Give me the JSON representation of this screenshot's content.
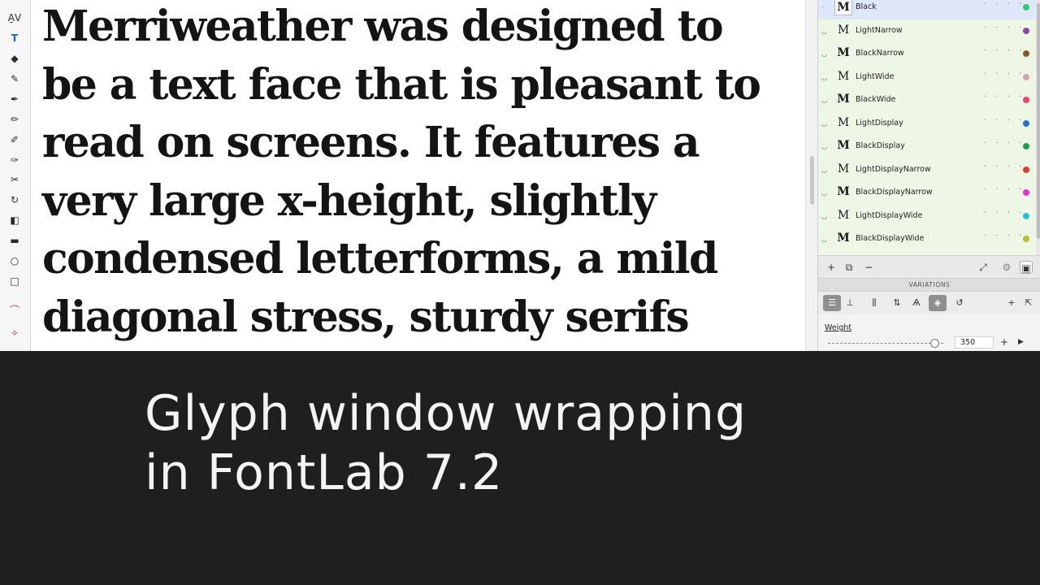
{
  "canvas": {
    "sample_text": "Merriweather was designed to\nbe a text face that is pleasant to\nread on screens. It features a\nvery large x-height, slightly\ncondensed letterforms, a mild\ndiagonal stress, sturdy serifs"
  },
  "toolbar": {
    "tools": [
      {
        "icon": "kerning-icon",
        "glyph": "A̱V",
        "active": false
      },
      {
        "icon": "text-tool-icon",
        "glyph": "T",
        "active": true
      },
      {
        "icon": "eraser-icon",
        "glyph": "◆",
        "active": false
      },
      {
        "icon": "brush-icon",
        "glyph": "✎",
        "active": false
      },
      {
        "icon": "pen-icon",
        "glyph": "✒",
        "active": false
      },
      {
        "icon": "pencil-icon",
        "glyph": "✏",
        "active": false
      },
      {
        "icon": "rapid-pen-icon",
        "glyph": "✐",
        "active": false
      },
      {
        "icon": "power-brush-icon",
        "glyph": "✑",
        "active": false
      },
      {
        "icon": "knife-icon",
        "glyph": "✂",
        "active": false
      },
      {
        "icon": "rotate-icon",
        "glyph": "↻",
        "active": false
      },
      {
        "icon": "fill-icon",
        "glyph": "◧",
        "active": false
      },
      {
        "icon": "ruler-icon",
        "glyph": "▬",
        "active": false
      },
      {
        "icon": "ellipse-icon",
        "glyph": "○",
        "active": false
      },
      {
        "icon": "rectangle-icon",
        "glyph": "□",
        "active": false
      },
      {
        "icon": "arc-icon",
        "glyph": "⌒",
        "active": false
      },
      {
        "icon": "guide-icon",
        "glyph": "⟡",
        "active": false
      }
    ]
  },
  "masters": {
    "items": [
      {
        "name": "Black",
        "glyph": "M",
        "glyph_weight": "bold",
        "visible": false,
        "selected": true,
        "color": "#2ecc71"
      },
      {
        "name": "LightNarrow",
        "glyph": "M",
        "glyph_weight": "normal",
        "visible": true,
        "selected": false,
        "color": "#8e44ad"
      },
      {
        "name": "BlackNarrow",
        "glyph": "M",
        "glyph_weight": "bold",
        "visible": true,
        "selected": false,
        "color": "#8b5a2b"
      },
      {
        "name": "LightWide",
        "glyph": "M",
        "glyph_weight": "normal",
        "visible": true,
        "selected": false,
        "color": "#d8a0b0"
      },
      {
        "name": "BlackWide",
        "glyph": "M",
        "glyph_weight": "bold",
        "visible": true,
        "selected": false,
        "color": "#e8457a"
      },
      {
        "name": "LightDisplay",
        "glyph": "M",
        "glyph_weight": "normal",
        "visible": true,
        "selected": false,
        "color": "#2a6fd6"
      },
      {
        "name": "BlackDisplay",
        "glyph": "M",
        "glyph_weight": "bold",
        "visible": true,
        "selected": false,
        "color": "#1f9e4a"
      },
      {
        "name": "LightDisplayNarrow",
        "glyph": "M",
        "glyph_weight": "normal",
        "visible": true,
        "selected": false,
        "color": "#e03a2e"
      },
      {
        "name": "BlackDisplayNarrow",
        "glyph": "M",
        "glyph_weight": "bold",
        "visible": true,
        "selected": false,
        "color": "#e630d8"
      },
      {
        "name": "LightDisplayWide",
        "glyph": "M",
        "glyph_weight": "normal",
        "visible": true,
        "selected": false,
        "color": "#22c3d0"
      },
      {
        "name": "BlackDisplayWide",
        "glyph": "M",
        "glyph_weight": "bold",
        "visible": true,
        "selected": false,
        "color": "#b5c22a"
      }
    ],
    "dots": "· · · ·",
    "footer": {
      "add": "+",
      "duplicate": "⧉",
      "remove": "−",
      "fit": "⤢",
      "gear": "⚙",
      "panel": "▣"
    }
  },
  "variations": {
    "header": "VARIATIONS",
    "tools": [
      {
        "icon": "sliders-icon",
        "glyph": "☰",
        "active": true
      },
      {
        "icon": "axis-icon",
        "glyph": "⊥",
        "active": false
      },
      {
        "icon": "masters-icon",
        "glyph": "⫼",
        "active": false
      },
      {
        "icon": "sort-icon",
        "glyph": "⇅",
        "active": false
      },
      {
        "icon": "compass-icon",
        "glyph": "Ѧ",
        "active": false
      },
      {
        "icon": "layers-icon",
        "glyph": "◈",
        "active": true
      },
      {
        "icon": "reset-icon",
        "glyph": "↺",
        "active": false
      }
    ],
    "add": "+",
    "export": "⇱",
    "axis": {
      "label": "Weight",
      "value": "350",
      "plus": "+",
      "play": "▶",
      "level": 0.96
    }
  },
  "caption": {
    "text": "Glyph window wrapping\nin FontLab 7.2"
  }
}
